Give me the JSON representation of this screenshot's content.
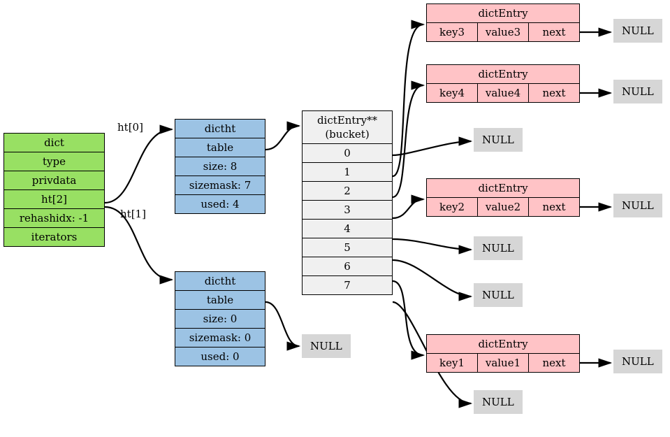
{
  "dict": {
    "title": "dict",
    "fields": [
      "type",
      "privdata",
      "ht[2]",
      "rehashidx: -1",
      "iterators"
    ]
  },
  "ht_labels": {
    "ht0": "ht[0]",
    "ht1": "ht[1]"
  },
  "dictht0": {
    "title": "dictht",
    "table": "table",
    "size": "size: 8",
    "sizemask": "sizemask: 7",
    "used": "used: 4"
  },
  "dictht1": {
    "title": "dictht",
    "table": "table",
    "size": "size: 0",
    "sizemask": "sizemask: 0",
    "used": "used: 0"
  },
  "bucket": {
    "title_l1": "dictEntry**",
    "title_l2": "(bucket)",
    "slots": [
      "0",
      "1",
      "2",
      "3",
      "4",
      "5",
      "6",
      "7"
    ]
  },
  "entries": {
    "e3": {
      "head": "dictEntry",
      "key": "key3",
      "value": "value3",
      "next": "next"
    },
    "e4": {
      "head": "dictEntry",
      "key": "key4",
      "value": "value4",
      "next": "next"
    },
    "e2": {
      "head": "dictEntry",
      "key": "key2",
      "value": "value2",
      "next": "next"
    },
    "e1": {
      "head": "dictEntry",
      "key": "key1",
      "value": "value1",
      "next": "next"
    }
  },
  "null_label": "NULL"
}
